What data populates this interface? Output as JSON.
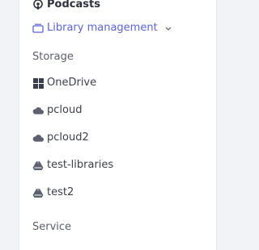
{
  "sidebar": {
    "podcasts": {
      "label": "Podcasts",
      "icon": "podcast-icon"
    },
    "library": {
      "label": "Library management",
      "icon": "library-icon",
      "expanded_icon": "chevron-down-icon"
    },
    "storage": {
      "title": "Storage",
      "items": [
        {
          "label": "OneDrive",
          "icon": "windows-icon"
        },
        {
          "label": "pcloud",
          "icon": "cloud-icon"
        },
        {
          "label": "pcloud2",
          "icon": "cloud-icon"
        },
        {
          "label": "test-libraries",
          "icon": "drive-icon"
        },
        {
          "label": "test2",
          "icon": "drive-icon"
        }
      ]
    },
    "service": {
      "title": "Service"
    }
  },
  "colors": {
    "accent": "#5b63d3",
    "text": "#3a3f4b",
    "icon": "#5c616d",
    "background": "#f2f3f6",
    "panel": "#ffffff"
  }
}
